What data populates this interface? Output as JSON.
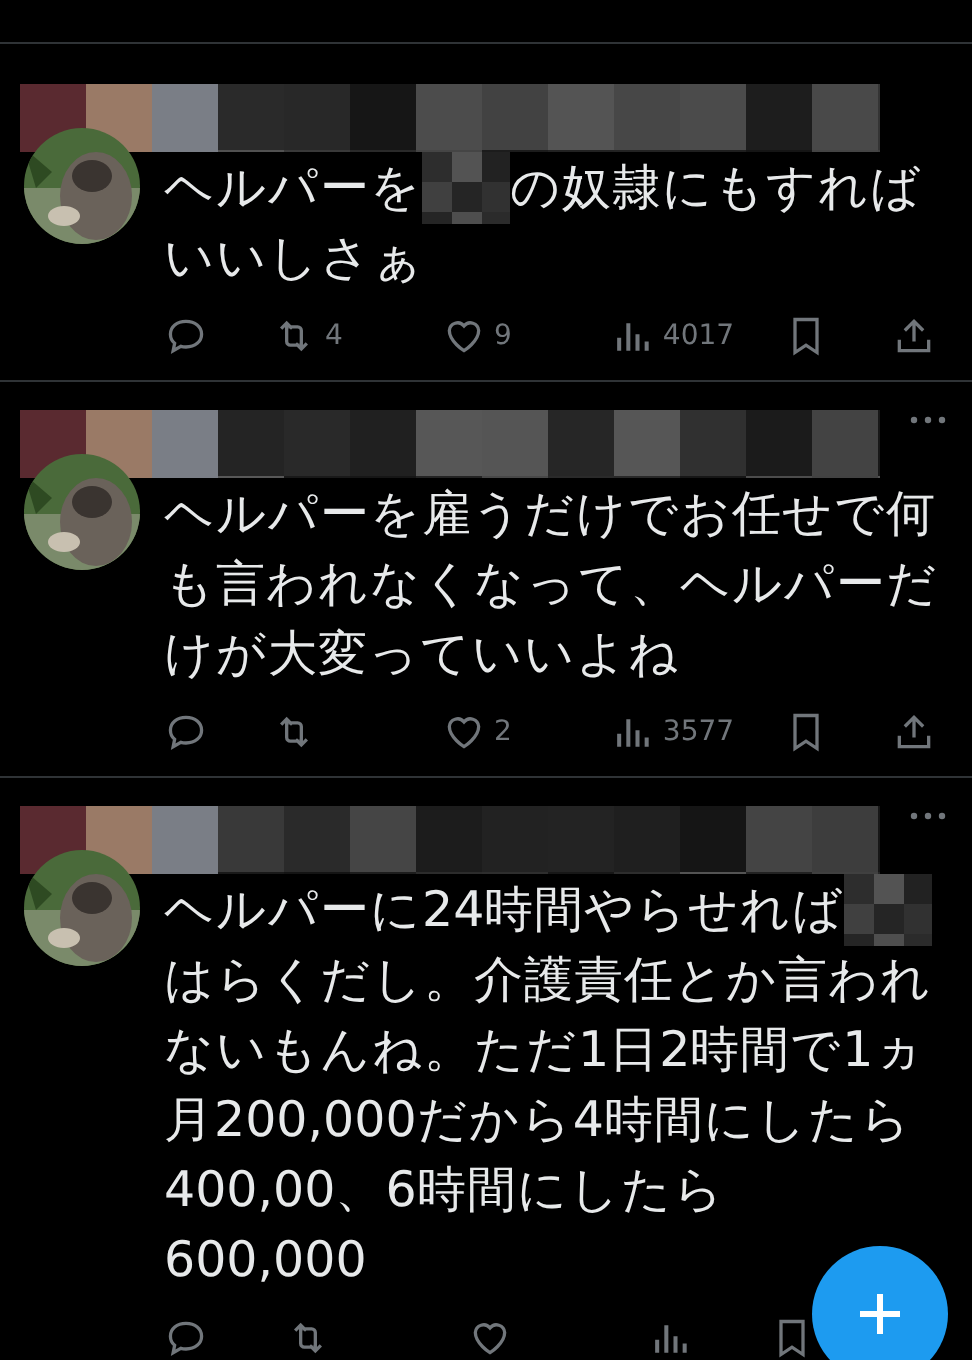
{
  "tweets": [
    {
      "more_menu": false,
      "lines": [
        [
          {
            "kind": "text",
            "text": "ヘルパーを"
          },
          {
            "kind": "mosaic"
          },
          {
            "kind": "text",
            "text": "の奴隷にもすれば"
          }
        ],
        [
          {
            "kind": "text",
            "text": "いいしさぁ"
          }
        ]
      ],
      "retweets": "4",
      "likes": "9",
      "views": "4017"
    },
    {
      "more_menu": true,
      "lines": [
        [
          {
            "kind": "text",
            "text": "ヘルパーを雇うだけでお任せで何"
          }
        ],
        [
          {
            "kind": "text",
            "text": "も言われなくなって、ヘルパーだ"
          }
        ],
        [
          {
            "kind": "text",
            "text": "けが大変っていいよね"
          }
        ]
      ],
      "likes": "2",
      "views": "3577"
    },
    {
      "more_menu": true,
      "lines": [
        [
          {
            "kind": "text",
            "text": "ヘルパーに24時間やらせれば"
          },
          {
            "kind": "mosaic"
          }
        ],
        [
          {
            "kind": "text",
            "text": "はらくだし。介護責任とか言われ"
          }
        ],
        [
          {
            "kind": "text",
            "text": "ないもんね。ただ1日2時間で1ヵ"
          }
        ],
        [
          {
            "kind": "text",
            "text": "月200,000だから4時間にしたら"
          }
        ],
        [
          {
            "kind": "text",
            "text": "400,00、6時間にしたら"
          }
        ],
        [
          {
            "kind": "text",
            "text": "600,000"
          }
        ]
      ]
    }
  ]
}
